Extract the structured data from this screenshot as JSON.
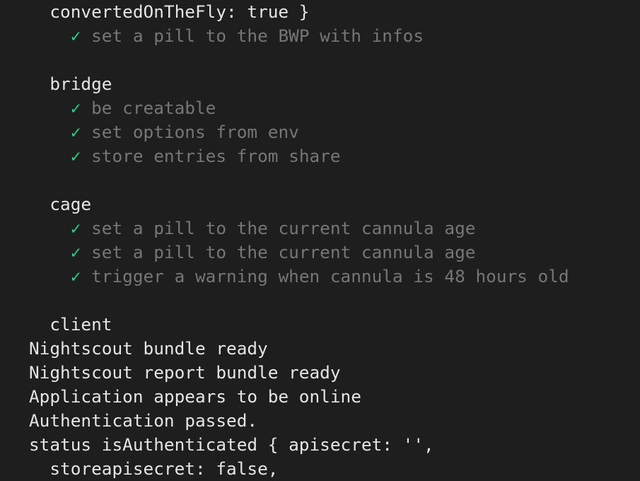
{
  "colors": {
    "background": "#1e1e1e",
    "text": "#e5e5e5",
    "pass_text": "#767676",
    "check": "#23d18b"
  },
  "check_glyph": "✓",
  "lines": [
    {
      "indent": 1,
      "text": "convertedOnTheFly: true }"
    },
    {
      "indent": 2,
      "pass": true,
      "text": "set a pill to the BWP with infos"
    },
    {
      "indent": 0,
      "text": ""
    },
    {
      "indent": 1,
      "text": "bridge"
    },
    {
      "indent": 2,
      "pass": true,
      "text": "be creatable"
    },
    {
      "indent": 2,
      "pass": true,
      "text": "set options from env"
    },
    {
      "indent": 2,
      "pass": true,
      "text": "store entries from share"
    },
    {
      "indent": 0,
      "text": ""
    },
    {
      "indent": 1,
      "text": "cage"
    },
    {
      "indent": 2,
      "pass": true,
      "text": "set a pill to the current cannula age"
    },
    {
      "indent": 2,
      "pass": true,
      "text": "set a pill to the current cannula age"
    },
    {
      "indent": 2,
      "pass": true,
      "text": "trigger a warning when cannula is 48 hours old"
    },
    {
      "indent": 0,
      "text": ""
    },
    {
      "indent": 1,
      "text": "client"
    },
    {
      "indent": 0,
      "text": "Nightscout bundle ready"
    },
    {
      "indent": 0,
      "text": "Nightscout report bundle ready"
    },
    {
      "indent": 0,
      "text": "Application appears to be online"
    },
    {
      "indent": 0,
      "text": "Authentication passed."
    },
    {
      "indent": 0,
      "text": "status isAuthenticated { apisecret: '',"
    },
    {
      "indent": 1,
      "text": "storeapisecret: false,"
    }
  ]
}
